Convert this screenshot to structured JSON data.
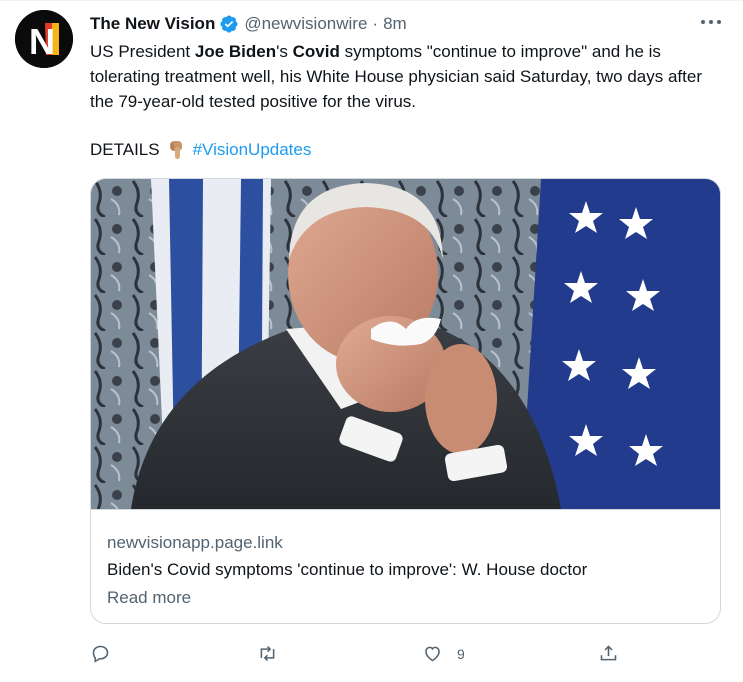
{
  "tweet": {
    "author_name": "The New Vision",
    "avatar_text": "N",
    "handle": "@newvisionwire",
    "separator": "·",
    "time": "8m",
    "text_parts": [
      "US President ",
      "Joe Biden",
      "'s ",
      "Covid",
      " symptoms \"continue to improve\" and he is tolerating treatment well, his White House physician said Saturday, two days after the 79-year-old tested positive for the virus."
    ],
    "details_label": "DETAILS",
    "hashtag": "#VisionUpdates"
  },
  "card": {
    "domain": "newvisionapp.page.link",
    "title": "Biden's Covid symptoms 'continue to improve': W. House doctor",
    "read_more": "Read more"
  },
  "actions": {
    "reply_count": "",
    "retweet_count": "",
    "like_count": "9",
    "share_count": ""
  },
  "icons": {
    "verified": "verified-badge-icon",
    "more": "more-options-icon",
    "reply": "reply-icon",
    "retweet": "retweet-icon",
    "like": "heart-icon",
    "share": "share-icon",
    "hand": "pointing-down-emoji"
  },
  "colors": {
    "accent": "#1d9bf0",
    "muted_text": "#536471",
    "border": "#cfd9de"
  }
}
